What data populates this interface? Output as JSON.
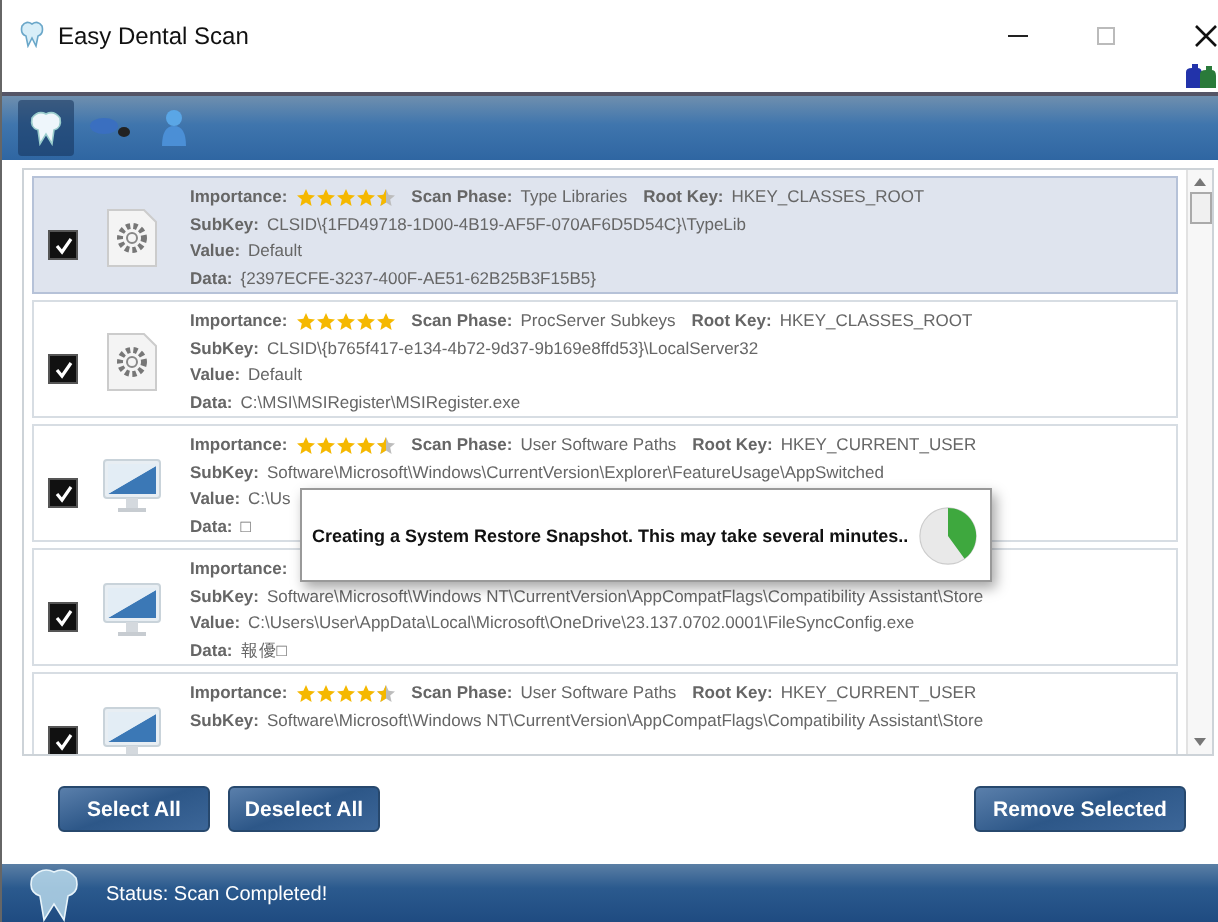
{
  "window": {
    "title": "Easy Dental Scan"
  },
  "toolbar": {
    "tabs": [
      {
        "selected": true
      },
      {
        "selected": false
      },
      {
        "selected": false
      }
    ]
  },
  "items": [
    {
      "checked": true,
      "selected": true,
      "kind": "gear",
      "importance_label": "Importance:",
      "stars": 4.5,
      "scan_phase_label": "Scan Phase:",
      "scan_phase": "Type Libraries",
      "root_key_label": "Root Key:",
      "root_key": "HKEY_CLASSES_ROOT",
      "subkey_label": "SubKey:",
      "subkey": "CLSID\\{1FD49718-1D00-4B19-AF5F-070AF6D5D54C}\\TypeLib",
      "value_label": "Value:",
      "value": "Default",
      "data_label": "Data:",
      "data": "{2397ECFE-3237-400F-AE51-62B25B3F15B5}"
    },
    {
      "checked": true,
      "selected": false,
      "kind": "gear",
      "importance_label": "Importance:",
      "stars": 5,
      "scan_phase_label": "Scan Phase:",
      "scan_phase": "ProcServer Subkeys",
      "root_key_label": "Root Key:",
      "root_key": "HKEY_CLASSES_ROOT",
      "subkey_label": "SubKey:",
      "subkey": "CLSID\\{b765f417-e134-4b72-9d37-9b169e8ffd53}\\LocalServer32",
      "value_label": "Value:",
      "value": "Default",
      "data_label": "Data:",
      "data": "C:\\MSI\\MSIRegister\\MSIRegister.exe"
    },
    {
      "checked": true,
      "selected": false,
      "kind": "monitor",
      "importance_label": "Importance:",
      "stars": 4.5,
      "scan_phase_label": "Scan Phase:",
      "scan_phase": "User Software Paths",
      "root_key_label": "Root Key:",
      "root_key": "HKEY_CURRENT_USER",
      "subkey_label": "SubKey:",
      "subkey": "Software\\Microsoft\\Windows\\CurrentVersion\\Explorer\\FeatureUsage\\AppSwitched",
      "value_label": "Value:",
      "value": "C:\\Us",
      "data_label": "Data:",
      "data": "□"
    },
    {
      "checked": true,
      "selected": false,
      "kind": "monitor",
      "importance_label": "Importance:",
      "subkey_label": "SubKey:",
      "subkey": "Software\\Microsoft\\Windows NT\\CurrentVersion\\AppCompatFlags\\Compatibility Assistant\\Store",
      "value_label": "Value:",
      "value": "C:\\Users\\User\\AppData\\Local\\Microsoft\\OneDrive\\23.137.0702.0001\\FileSyncConfig.exe",
      "data_label": "Data:",
      "data": "報優□"
    },
    {
      "checked": true,
      "selected": false,
      "kind": "monitor",
      "importance_label": "Importance:",
      "stars": 4.5,
      "scan_phase_label": "Scan Phase:",
      "scan_phase": "User Software Paths",
      "root_key_label": "Root Key:",
      "root_key": "HKEY_CURRENT_USER",
      "subkey_label": "SubKey:",
      "subkey": "Software\\Microsoft\\Windows NT\\CurrentVersion\\AppCompatFlags\\Compatibility Assistant\\Store"
    }
  ],
  "dialog": {
    "message": "Creating a System Restore Snapshot. This may take several minutes.."
  },
  "buttons": {
    "select_all": "Select All",
    "deselect_all": "Deselect All",
    "remove": "Remove Selected"
  },
  "status_bar": {
    "text": "Status: Scan Completed!"
  }
}
